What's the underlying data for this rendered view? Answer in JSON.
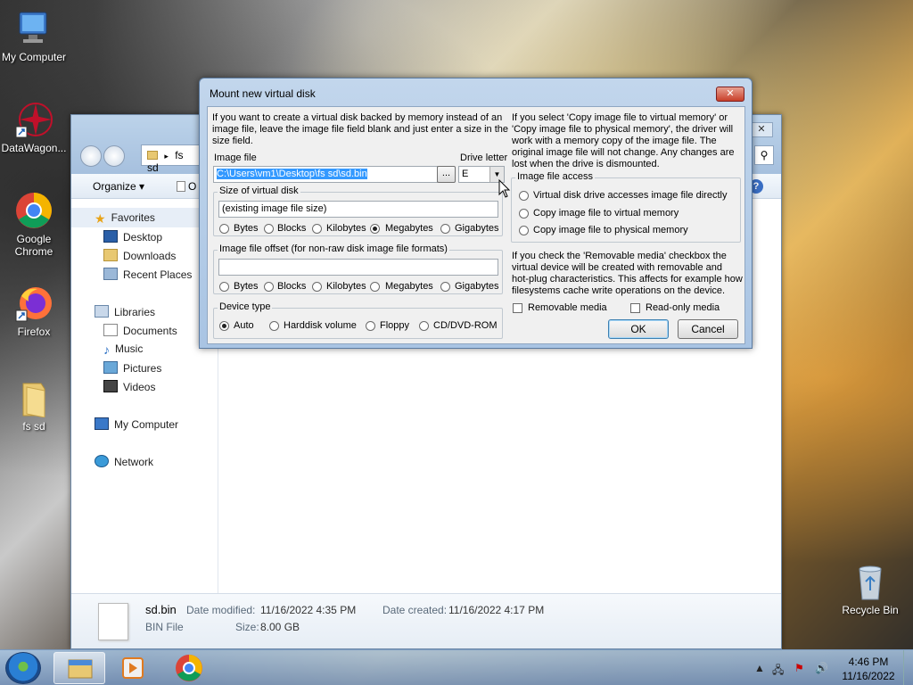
{
  "desktop": {
    "icons": [
      {
        "label": "My Computer"
      },
      {
        "label": "DataWagon..."
      },
      {
        "label": "Google Chrome"
      },
      {
        "label": "Firefox"
      },
      {
        "label": "fs sd"
      },
      {
        "label": "Recycle Bin"
      }
    ]
  },
  "explorer": {
    "address": "fs sd",
    "organize_label": "Organize ▾",
    "toolbar_partial": "O",
    "nav": {
      "favorites": "Favorites",
      "desktop": "Desktop",
      "downloads": "Downloads",
      "recent": "Recent Places",
      "libraries": "Libraries",
      "documents": "Documents",
      "music": "Music",
      "pictures": "Pictures",
      "videos": "Videos",
      "my_computer": "My Computer",
      "network": "Network"
    },
    "details": {
      "name": "sd.bin",
      "type": "BIN File",
      "modified_label": "Date modified:",
      "modified_value": "11/16/2022 4:35 PM",
      "size_label": "Size:",
      "size_value": "8.00 GB",
      "created_label": "Date created:",
      "created_value": "11/16/2022 4:17 PM"
    }
  },
  "dialog": {
    "title": "Mount new virtual disk",
    "intro_left": [
      "If you want to create a virtual disk backed by memory instead of an",
      "image file, leave the image file field blank and just enter a size in the",
      "size field."
    ],
    "image_file_label": "Image file",
    "image_file_value": "C:\\Users\\vm1\\Desktop\\fs sd\\sd.bin",
    "browse_label": "...",
    "drive_letter_label": "Drive letter",
    "drive_letter_value": "E",
    "size_group": "Size of virtual disk",
    "size_value": "(existing image file size)",
    "units": [
      "Bytes",
      "Blocks",
      "Kilobytes",
      "Megabytes",
      "Gigabytes"
    ],
    "offset_group": "Image file offset (for non-raw disk image file formats)",
    "offset_value": "",
    "device_group": "Device type",
    "device_types": [
      "Auto",
      "Harddisk volume",
      "Floppy",
      "CD/DVD-ROM"
    ],
    "intro_right": [
      "If you select 'Copy image file to virtual memory' or",
      "'Copy image file to physical memory', the driver will",
      "work with a memory copy of the image file. The",
      "original image file will not change. Any changes are",
      "lost when the drive is dismounted."
    ],
    "access_group": "Image file access",
    "access_options": [
      "Virtual disk drive accesses image file directly",
      "Copy image file to virtual memory",
      "Copy image file to physical memory"
    ],
    "removable_info": [
      "If you check the 'Removable media' checkbox the",
      "virtual device will be created with removable and",
      "hot-plug characteristics. This affects for example how",
      "filesystems cache write operations on the device."
    ],
    "removable_label": "Removable media",
    "readonly_label": "Read-only media",
    "ok_label": "OK",
    "cancel_label": "Cancel"
  },
  "taskbar": {
    "time": "4:46 PM",
    "date": "11/16/2022"
  }
}
